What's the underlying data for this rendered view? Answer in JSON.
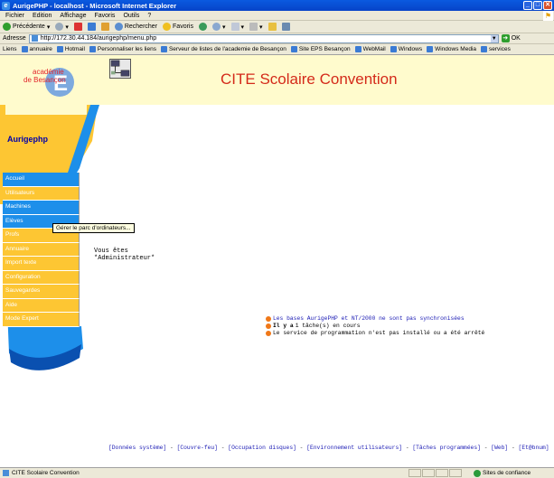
{
  "window": {
    "title": "AurigePHP - localhost - Microsoft Internet Explorer"
  },
  "menubar": {
    "items": [
      "Fichier",
      "Edition",
      "Affichage",
      "Favoris",
      "Outils",
      "?"
    ]
  },
  "toolbar": {
    "back": "Précédente",
    "search": "Rechercher",
    "favorites": "Favoris"
  },
  "address": {
    "label": "Adresse",
    "url": "http://172.30.44.184/aurigephp/menu.php",
    "go": "OK"
  },
  "links": {
    "label": "Liens",
    "items": [
      "annuaire",
      "Hotmail",
      "Personnaliser les liens",
      "Serveur de listes de l'academie de Besançon",
      "Site EPS Besançon",
      "WebMail",
      "Windows",
      "Windows Media",
      "services"
    ]
  },
  "page": {
    "logo_text": "académie\nde Besançon",
    "logo_letter": "E",
    "title": "CITE Scolaire Convention",
    "sidebar_title": "Aurigephp",
    "nav": [
      {
        "label": "Accueil",
        "color": "blue"
      },
      {
        "label": "Utilisateurs",
        "color": "yellow"
      },
      {
        "label": "Machines",
        "color": "blue"
      },
      {
        "label": "Elèves",
        "color": "blue"
      },
      {
        "label": "Profs",
        "color": "yellow"
      },
      {
        "label": "Annuaire",
        "color": "yellow"
      },
      {
        "label": "Import texte",
        "color": "yellow"
      },
      {
        "label": "Configuration",
        "color": "yellow"
      },
      {
        "label": "Sauvegardes",
        "color": "yellow"
      },
      {
        "label": "Aide",
        "color": "yellow"
      },
      {
        "label": "Mode Expert",
        "color": "yellow"
      }
    ],
    "tooltip": "Gérer le parc d'ordinateurs...",
    "user_line1": "Vous êtes",
    "user_line2": "*Administrateur*",
    "messages": [
      {
        "text": "Les bases AurigePHP et NT/2000 ne sont pas synchronisées",
        "link": true
      },
      {
        "bold": "Il y a",
        "text": " 1 tâche(s) en cours",
        "link": false
      },
      {
        "text": "Le service de programmation n'est pas installé ou a été arrêté",
        "link": false
      }
    ],
    "footer": [
      "[Données système]",
      "[Couvre-feu]",
      "[Occupation disques]",
      "[Environnement utilisateurs]",
      "[Tâches programmées]",
      "[Web]",
      "[Et@bnum]"
    ]
  },
  "status": {
    "text": "CITE Scolaire Convention",
    "zone": "Sites de confiance"
  },
  "colors": {
    "title_red": "#d42a1a",
    "nav_blue": "#1d8fea",
    "nav_yellow": "#fdc633",
    "banner": "#fffbcd"
  }
}
